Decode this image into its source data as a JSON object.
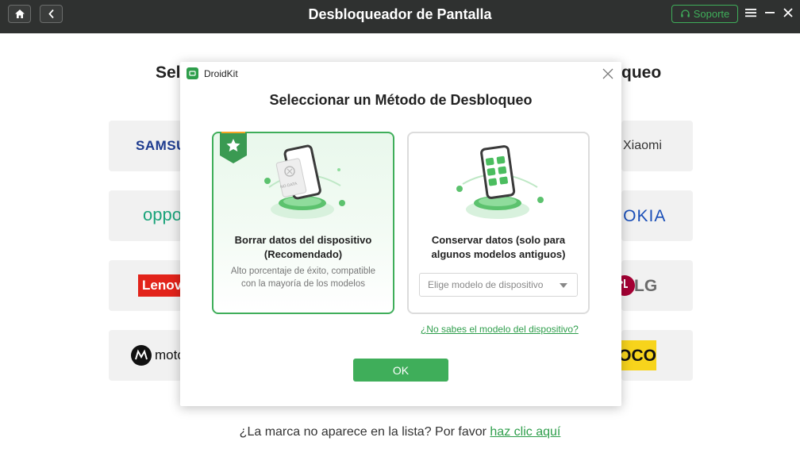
{
  "window": {
    "title": "Desbloqueador de Pantalla",
    "support_label": "Soporte"
  },
  "background": {
    "heading_left": "Sel",
    "heading_right": "queo",
    "brands": {
      "samsung": "SAMSUNG",
      "xiaomi": "Xiaomi",
      "oppo": "oppo",
      "nokia": "NOKIA",
      "lenovo": "Lenovo",
      "lg": "LG",
      "motorola": "moto",
      "poco": "POCO"
    },
    "footer_text": "¿La marca no aparece en la lista? Por favor ",
    "footer_link": "haz clic aquí"
  },
  "dialog": {
    "app_name": "DroidKit",
    "title": "Seleccionar un Método de Desbloqueo",
    "option_erase": {
      "title": "Borrar datos del dispositivo (Recomendado)",
      "description": "Alto porcentaje de éxito, compatible con la mayoría de los modelos",
      "phone_label": "NO DATA"
    },
    "option_keep": {
      "title": "Conservar datos (solo para algunos modelos antiguos)",
      "select_placeholder": "Elige modelo de dispositivo"
    },
    "help_link": "¿No sabes el modelo del dispositivo?",
    "ok_label": "OK"
  },
  "colors": {
    "accent": "#3fae5a",
    "titlebar": "#2f3130"
  }
}
